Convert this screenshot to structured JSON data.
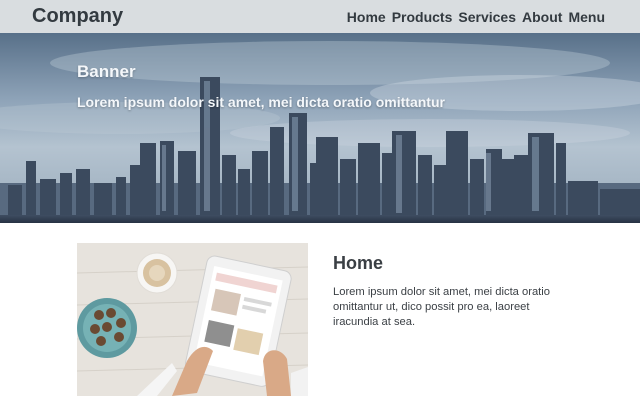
{
  "header": {
    "logo": "Company",
    "nav": [
      {
        "label": "Home"
      },
      {
        "label": "Products"
      },
      {
        "label": "Services"
      },
      {
        "label": "About"
      },
      {
        "label": "Menu"
      }
    ]
  },
  "banner": {
    "title": "Banner",
    "subtitle": "Lorem ipsum dolor sit amet, mei dicta oratio omittantur"
  },
  "content": {
    "title": "Home",
    "text": "Lorem ipsum dolor sit amet, mei dicta oratio omittantur ut, dico possit pro ea, laoreet iracundia at sea."
  },
  "colors": {
    "header_bg": "#d9dde0",
    "text_dark": "#333a40",
    "banner_text": "#f4f7fa"
  }
}
